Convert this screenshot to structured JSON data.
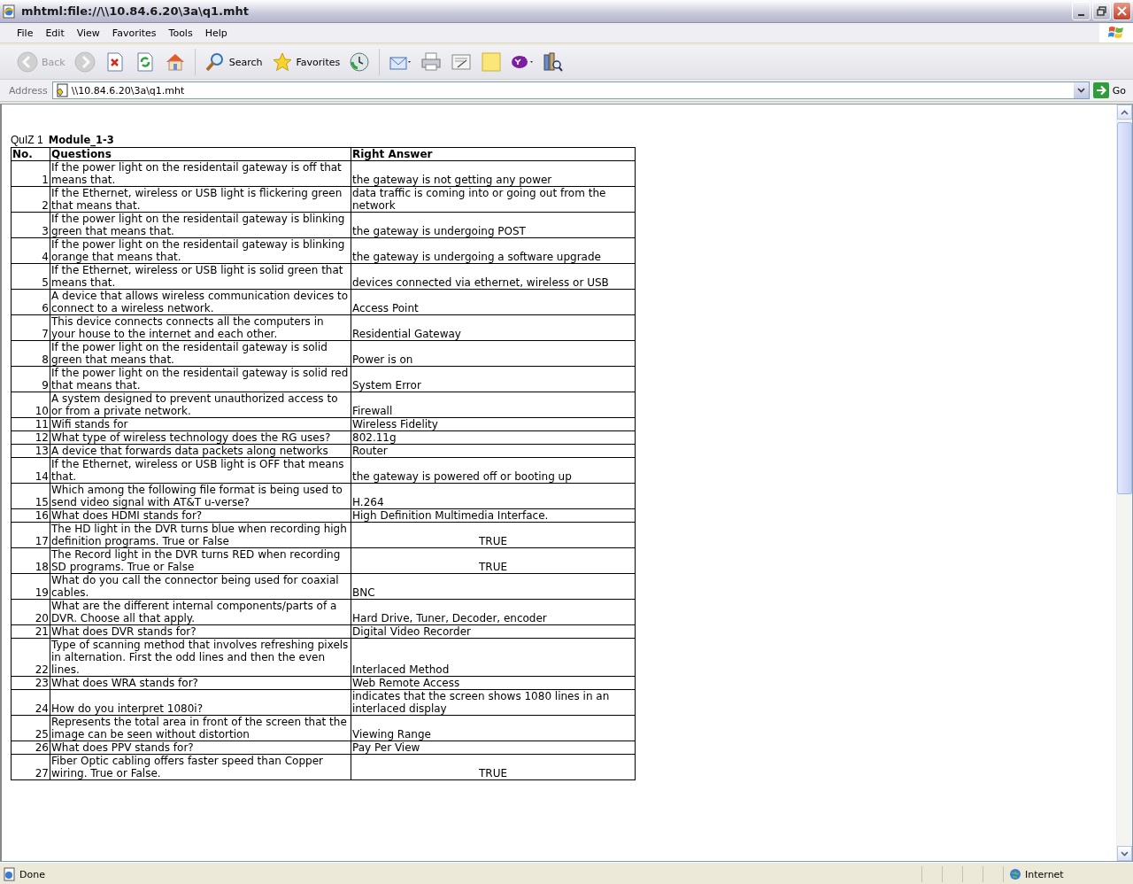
{
  "window": {
    "title": "mhtml:file://\\\\10.84.6.20\\3a\\q1.mht"
  },
  "menu": [
    "File",
    "Edit",
    "View",
    "Favorites",
    "Tools",
    "Help"
  ],
  "toolbar": [
    {
      "kind": "back",
      "label": "Back",
      "disabled": true
    },
    {
      "kind": "forward",
      "disabled": true
    },
    {
      "kind": "stop",
      "disabled": false
    },
    {
      "kind": "refresh",
      "disabled": false
    },
    {
      "kind": "home",
      "disabled": false
    },
    {
      "kind": "search",
      "label": "Search",
      "disabled": false
    },
    {
      "kind": "favorites",
      "label": "Favorites",
      "disabled": false
    },
    {
      "kind": "history",
      "disabled": false
    },
    {
      "kind": "mail",
      "disabled": false
    },
    {
      "kind": "print",
      "disabled": false
    },
    {
      "kind": "edit",
      "disabled": false
    },
    {
      "kind": "note",
      "disabled": false
    },
    {
      "kind": "yahoo",
      "disabled": false
    },
    {
      "kind": "research",
      "disabled": false
    }
  ],
  "address": {
    "label": "Address",
    "value": "\\\\10.84.6.20\\3a\\q1.mht",
    "go": "Go"
  },
  "page": {
    "quiz_label": "QuIZ 1",
    "heading": "Module_1-3",
    "columns": [
      "No.",
      "Questions",
      "Right Answer"
    ],
    "rows": [
      {
        "no": "1",
        "question": "If the power light on the residentail gateway is off that means that.",
        "answer": "the gateway is not getting any power",
        "centered": false
      },
      {
        "no": "2",
        "question": "If the Ethernet, wireless or USB light is flickering green that means that.",
        "answer": "data traffic is coming into or going out from the network",
        "centered": false
      },
      {
        "no": "3",
        "question": "If the power light on the residentail gateway is blinking green that means that.",
        "answer": "the gateway is undergoing POST",
        "centered": false
      },
      {
        "no": "4",
        "question": "If the power light on the residentail gateway is blinking orange that means that.",
        "answer": "the gateway is undergoing a software upgrade",
        "centered": false
      },
      {
        "no": "5",
        "question": "If the Ethernet, wireless or USB light is solid green that means that.",
        "answer": "devices connected via ethernet, wireless or USB",
        "centered": false
      },
      {
        "no": "6",
        "question": "A device that allows wireless communication devices to connect to a wireless network.",
        "answer": "Access Point",
        "centered": false
      },
      {
        "no": "7",
        "question": "This device connects connects all the computers in your house to the internet and each other.",
        "answer": "Residential Gateway",
        "centered": false
      },
      {
        "no": "8",
        "question": "If the power light on the residentail gateway is solid green that means that.",
        "answer": "Power is on",
        "centered": false
      },
      {
        "no": "9",
        "question": "If the power light on the residentail gateway is solid red that means that.",
        "answer": "System Error",
        "centered": false
      },
      {
        "no": "10",
        "question": "A system designed to prevent unauthorized access to or from a private network.",
        "answer": "Firewall",
        "centered": false
      },
      {
        "no": "11",
        "question": "Wifi stands for",
        "answer": "Wireless Fidelity",
        "centered": false
      },
      {
        "no": "12",
        "question": "What type of wireless technology does the RG uses?",
        "answer": "802.11g",
        "centered": false
      },
      {
        "no": "13",
        "question": "A device that forwards data packets along networks",
        "answer": "Router",
        "centered": false
      },
      {
        "no": "14",
        "question": "If the Ethernet, wireless or USB light is OFF that means that.",
        "answer": "the gateway is powered off or booting up",
        "centered": false
      },
      {
        "no": "15",
        "question": "Which among the following file format is being used to send video signal with AT&T u-verse?",
        "answer": "H.264",
        "centered": false
      },
      {
        "no": "16",
        "question": "What does HDMI stands for?",
        "answer": "High Definition Multimedia Interface.",
        "centered": false
      },
      {
        "no": "17",
        "question": "The HD light in the DVR turns blue when recording high definition programs. True or False",
        "answer": "TRUE",
        "centered": true
      },
      {
        "no": "18",
        "question": "The Record light in the DVR turns RED when recording SD programs. True or False",
        "answer": "TRUE",
        "centered": true
      },
      {
        "no": "19",
        "question": "What do you call the connector being used for coaxial cables.",
        "answer": "BNC",
        "centered": false
      },
      {
        "no": "20",
        "question": "What are the different internal components/parts of a DVR. Choose all that apply.",
        "answer": "Hard Drive, Tuner, Decoder, encoder",
        "centered": false
      },
      {
        "no": "21",
        "question": "What does DVR stands for?",
        "answer": "Digital Video Recorder",
        "centered": false
      },
      {
        "no": "22",
        "question": "Type of scanning method that involves refreshing pixels in alternation. First the odd lines and then the even lines.",
        "answer": "Interlaced Method",
        "centered": false
      },
      {
        "no": "23",
        "question": "What does WRA stands for?",
        "answer": "Web Remote Access",
        "centered": false
      },
      {
        "no": "24",
        "question": "How do you interpret 1080i?",
        "answer": "indicates that the screen shows 1080 lines in an interlaced display",
        "centered": false
      },
      {
        "no": "25",
        "question": "Represents the total area in front of the screen that the image can be seen without distortion",
        "answer": "Viewing Range",
        "centered": false
      },
      {
        "no": "26",
        "question": "What does PPV stands for?",
        "answer": "Pay Per View",
        "centered": false
      },
      {
        "no": "27",
        "question": "Fiber Optic cabling offers faster speed than Copper wiring. True or False.",
        "answer": "TRUE",
        "centered": true
      }
    ]
  },
  "status_bar": {
    "text": "Done",
    "zone": "Internet"
  }
}
